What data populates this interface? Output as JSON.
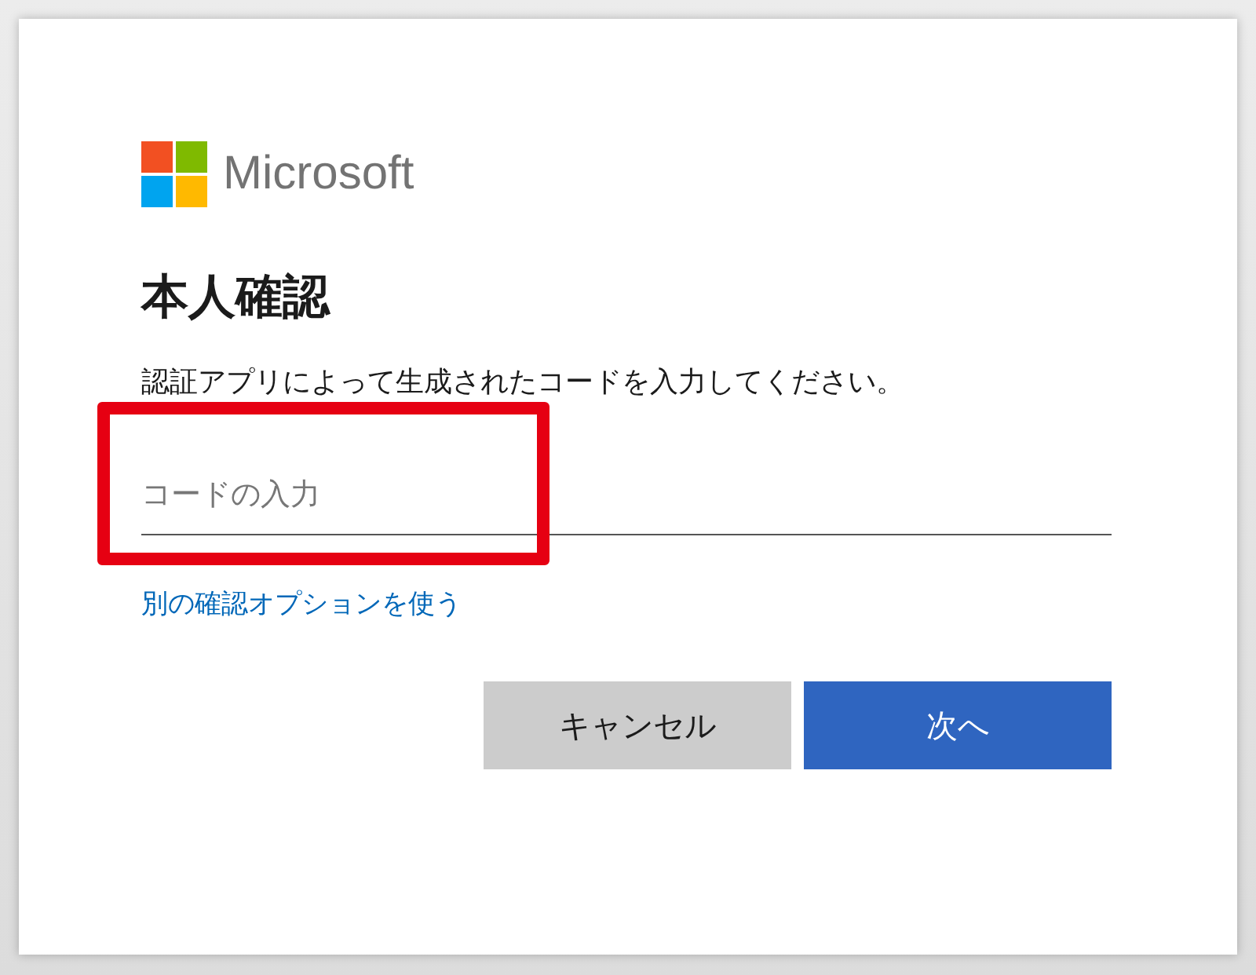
{
  "brand": {
    "name": "Microsoft"
  },
  "title": "本人確認",
  "description": "認証アプリによって生成されたコードを入力してください。",
  "code_field": {
    "placeholder": "コードの入力",
    "highlighted": true
  },
  "link": "別の確認オプションを使う",
  "buttons": [
    {
      "label": "キャンセル",
      "kind": "secondary"
    },
    {
      "label": "次へ",
      "kind": "primary"
    }
  ]
}
